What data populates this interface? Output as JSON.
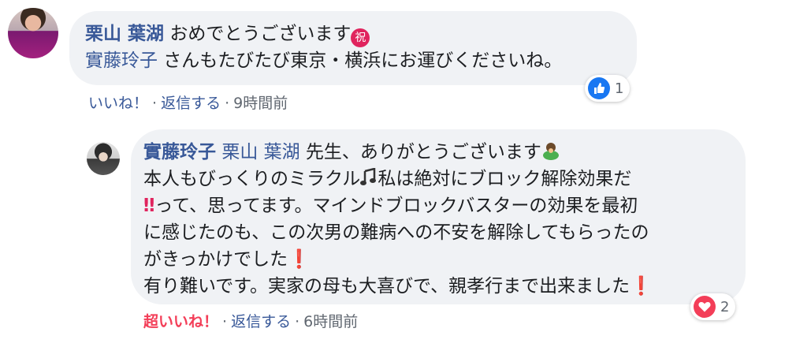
{
  "comment1": {
    "author": "栗山 葉湖",
    "line1_text": " おめでとうございます",
    "line1_emoji": "祝",
    "mention": "實藤玲子",
    "line2_text": " さんもたびたび東京・横浜にお運びくださいね。",
    "reaction_count": "1",
    "like_label": "いいね！",
    "reply_label": "返信する",
    "time": "9時間前",
    "separator": "·"
  },
  "reply1": {
    "author": "實藤玲子",
    "mention": "栗山 葉湖",
    "line1_text": " 先生、ありがとうございます",
    "line2_text": "本人もびっくりのミラクル",
    "line2_emoji": "🎵",
    "line2_tail": "私は絶対にブロック解除効果だ",
    "line3_emoji": "‼",
    "line3_text": "って、思ってます。マインドブロックバスターの効果を最初",
    "line4_text": "に感じたのも、この次男の難病への不安を解除してもらったの",
    "line5_text": "がきっかけでした",
    "line5_emoji": "❗",
    "line6_text": "有り難いです。実家の母も大喜びで、親孝行まで出来ました",
    "line6_emoji": "❗",
    "reaction_count": "2",
    "love_label": "超いいね！",
    "reply_label": "返信する",
    "time": "6時間前",
    "separator": "·"
  },
  "icons": {
    "like": "like-thumb-icon",
    "love": "heart-icon",
    "pray": "bowing-person-emoji"
  },
  "colors": {
    "link": "#385898",
    "bubble": "#f0f2f5",
    "meta": "#606770",
    "love": "#f33e58",
    "like": "#1877f2"
  }
}
